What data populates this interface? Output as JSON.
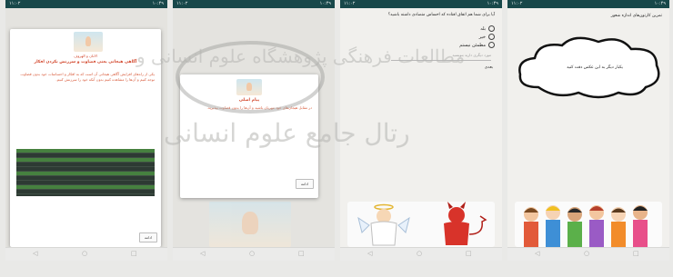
{
  "screens": [
    {
      "status_left": "۱۱:۰۲",
      "status_right": "۱۰:۴۹",
      "card_title_line1": "الانان و الهروف",
      "card_title_line2": "آگاهی هیجانی یعنی قضاوت و سرزنش نکردن افکار",
      "body_text": "یکی از راه‌های افزایش آگاهی هیجانی آن است که به افکار و احساسات خود بدون قضاوت توجه کنیم و آن‌ها را مشاهده کنیم بدون آنکه خود را سرزنش کنیم.",
      "button_label": "ادامه"
    },
    {
      "status_left": "۱۱:۰۲",
      "status_right": "۱۰:۴۹",
      "card_title": "پیام اصلی",
      "body_text": "در مقابل هیجان‌های خود مهربان باشید و آن‌ها را بدون قضاوت بپذیرید.",
      "button_label": "ادامه"
    },
    {
      "status_left": "۱۱:۰۲",
      "status_right": "۱۰:۴۹",
      "question": "آیا برای شما هم اتفاق افتاده که احساس متضادی داشته باشید؟",
      "options": [
        "بله",
        "خیر",
        "مطمئن نیستم"
      ],
      "input_placeholder": "مورد دیگری دارید بنویسید",
      "footer_label": "بعدی"
    },
    {
      "status_left": "۱۱:۰۲",
      "status_right": "۱۰:۴۹",
      "header_text": "تمرین کارتون‌های اندازه شعور",
      "cloud_text": "یکبار دیگر به این عکس دقت کنید"
    }
  ],
  "watermarks": {
    "line1": "مطالعات فرهنگی پژوهشگاه علوم انسانی و",
    "line2": "رتال جامع علوم انسانی"
  },
  "colors": {
    "statusbar": "#18484a",
    "accent_text": "#d2452a",
    "table_green": "#46813f"
  }
}
